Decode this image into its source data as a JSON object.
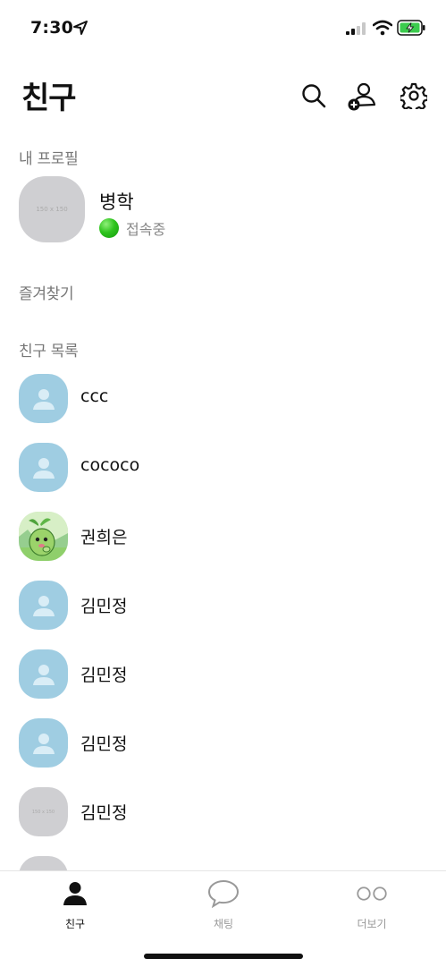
{
  "status_bar": {
    "time": "7:30",
    "icons": [
      "location-arrow-icon",
      "signal-icon",
      "wifi-icon",
      "battery-charging-icon"
    ]
  },
  "header": {
    "title": "친구",
    "actions": [
      "search-icon",
      "add-friend-icon",
      "settings-gear-icon"
    ]
  },
  "sections": {
    "my_profile": "내 프로필",
    "favorites": "즐겨찾기",
    "friends": "친구 목록"
  },
  "my_profile": {
    "name": "병학",
    "status": "접속중",
    "avatar_placeholder": "150 x 150",
    "status_color": "#2fc41e"
  },
  "friends": [
    {
      "name": "ccc",
      "avatar": "default"
    },
    {
      "name": "cococo",
      "avatar": "default"
    },
    {
      "name": "권희은",
      "avatar": "custom"
    },
    {
      "name": "김민정",
      "avatar": "default"
    },
    {
      "name": "김민정",
      "avatar": "default"
    },
    {
      "name": "김민정",
      "avatar": "default"
    },
    {
      "name": "김민정",
      "avatar": "placeholder",
      "avatar_placeholder": "150 x 150"
    }
  ],
  "tab_bar": {
    "tabs": [
      {
        "label": "친구",
        "icon": "person-icon",
        "active": true
      },
      {
        "label": "채팅",
        "icon": "chat-bubble-icon",
        "active": false
      },
      {
        "label": "더보기",
        "icon": "more-circles-icon",
        "active": false
      }
    ]
  },
  "colors": {
    "default_avatar": "#9fcde2",
    "placeholder_avatar": "#cfcfd2",
    "section_label": "#777777"
  }
}
